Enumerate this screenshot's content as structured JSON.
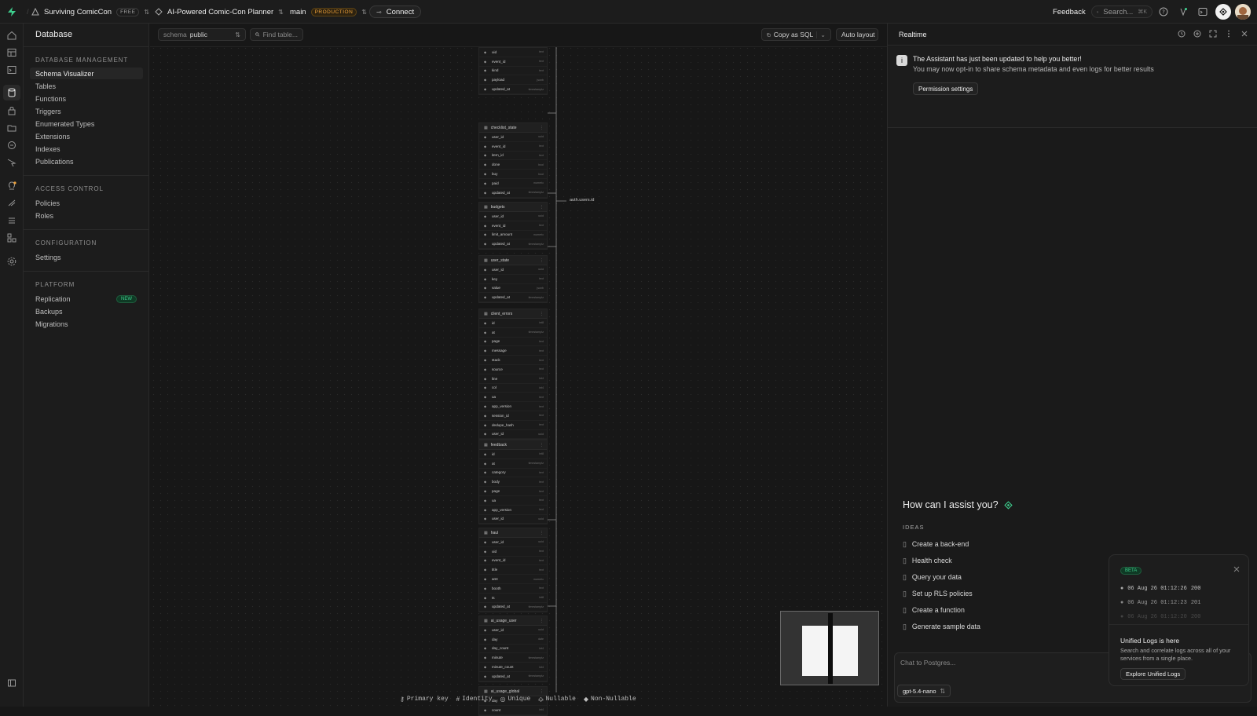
{
  "topbar": {
    "org_name": "Surviving ComicCon",
    "org_plan": "FREE",
    "project_name": "AI-Powered Comic-Con Planner",
    "branch_name": "main",
    "branch_env": "PRODUCTION",
    "connect_label": "Connect",
    "feedback_label": "Feedback",
    "search_placeholder": "Search...",
    "search_shortcut": "⌘K"
  },
  "sidebar": {
    "title": "Database",
    "groups": [
      {
        "heading": "DATABASE MANAGEMENT",
        "items": [
          "Schema Visualizer",
          "Tables",
          "Functions",
          "Triggers",
          "Enumerated Types",
          "Extensions",
          "Indexes",
          "Publications"
        ]
      },
      {
        "heading": "ACCESS CONTROL",
        "items": [
          "Policies",
          "Roles"
        ]
      },
      {
        "heading": "CONFIGURATION",
        "items": [
          "Settings"
        ]
      },
      {
        "heading": "PLATFORM",
        "items": [
          "Replication",
          "Backups",
          "Migrations"
        ]
      }
    ],
    "active_item": "Schema Visualizer",
    "new_badge": "NEW"
  },
  "toolbar": {
    "schema_label": "schema",
    "schema_value": "public",
    "find_placeholder": "Find table...",
    "copy_sql_label": "Copy as SQL",
    "auto_layout_label": "Auto layout"
  },
  "canvas": {
    "fk_label": "auth.users.id",
    "tables": [
      {
        "name": "",
        "columns": [
          [
            "uid",
            "text"
          ],
          [
            "event_id",
            "text"
          ],
          [
            "kind",
            "text"
          ],
          [
            "payload",
            "jsonb"
          ],
          [
            "updated_at",
            "timestamptz"
          ]
        ]
      },
      {
        "name": "checklist_state",
        "columns": [
          [
            "user_id",
            "uuid"
          ],
          [
            "event_id",
            "text"
          ],
          [
            "item_id",
            "text"
          ],
          [
            "done",
            "bool"
          ],
          [
            "buy",
            "bool"
          ],
          [
            "paid",
            "numeric"
          ],
          [
            "updated_at",
            "timestamptz"
          ]
        ]
      },
      {
        "name": "budgets",
        "columns": [
          [
            "user_id",
            "uuid"
          ],
          [
            "event_id",
            "text"
          ],
          [
            "limit_amount",
            "numeric"
          ],
          [
            "updated_at",
            "timestamptz"
          ]
        ]
      },
      {
        "name": "user_state",
        "columns": [
          [
            "user_id",
            "uuid"
          ],
          [
            "key",
            "text"
          ],
          [
            "value",
            "jsonb"
          ],
          [
            "updated_at",
            "timestamptz"
          ]
        ]
      },
      {
        "name": "client_errors",
        "columns": [
          [
            "id",
            "int8"
          ],
          [
            "at",
            "timestamptz"
          ],
          [
            "page",
            "text"
          ],
          [
            "message",
            "text"
          ],
          [
            "stack",
            "text"
          ],
          [
            "source",
            "text"
          ],
          [
            "line",
            "int4"
          ],
          [
            "col",
            "int4"
          ],
          [
            "ua",
            "text"
          ],
          [
            "app_version",
            "text"
          ],
          [
            "session_id",
            "text"
          ],
          [
            "dedupe_hash",
            "text"
          ],
          [
            "user_id",
            "uuid"
          ]
        ]
      },
      {
        "name": "feedback",
        "columns": [
          [
            "id",
            "int8"
          ],
          [
            "at",
            "timestamptz"
          ],
          [
            "category",
            "text"
          ],
          [
            "body",
            "text"
          ],
          [
            "page",
            "text"
          ],
          [
            "ua",
            "text"
          ],
          [
            "app_version",
            "text"
          ],
          [
            "user_id",
            "uuid"
          ]
        ]
      },
      {
        "name": "haul",
        "columns": [
          [
            "user_id",
            "uuid"
          ],
          [
            "uid",
            "text"
          ],
          [
            "event_id",
            "text"
          ],
          [
            "title",
            "text"
          ],
          [
            "amt",
            "numeric"
          ],
          [
            "booth",
            "text"
          ],
          [
            "ts",
            "int8"
          ],
          [
            "updated_at",
            "timestamptz"
          ]
        ]
      },
      {
        "name": "ai_usage_user",
        "columns": [
          [
            "user_id",
            "uuid"
          ],
          [
            "day",
            "date"
          ],
          [
            "day_count",
            "int4"
          ],
          [
            "minute",
            "timestamptz"
          ],
          [
            "minute_count",
            "int4"
          ],
          [
            "updated_at",
            "timestamptz"
          ]
        ]
      },
      {
        "name": "ai_usage_global",
        "columns": [
          [
            "day",
            "date"
          ],
          [
            "count",
            "int4"
          ]
        ]
      }
    ],
    "legend": [
      "Primary key",
      "Identity",
      "Unique",
      "Nullable",
      "Non-Nullable"
    ]
  },
  "panel": {
    "title": "Realtime",
    "notice_title": "The Assistant has just been updated to help you better!",
    "notice_body": "You may now opt-in to share schema metadata and even logs for better results",
    "permission_button": "Permission settings",
    "assist_heading": "How can I assist you?",
    "ideas_heading": "IDEAS",
    "ideas": [
      "Create a back-end",
      "Health check",
      "Query your data",
      "Set up RLS policies",
      "Create a function",
      "Generate sample data"
    ],
    "chat_placeholder": "Chat to Postgres...",
    "model": "gpt-5.4-nano"
  },
  "logs_popup": {
    "badge": "BETA",
    "entries": [
      {
        "time": "06 Aug 26 01:12:26",
        "status": "200"
      },
      {
        "time": "06 Aug 26 01:12:23",
        "status": "201"
      },
      {
        "time": "06 Aug 26 01:12:20",
        "status": "200"
      }
    ],
    "title": "Unified Logs is here",
    "body": "Search and correlate logs across all of your services from a single place.",
    "button": "Explore Unified Logs"
  },
  "colors": {
    "brand": "#3ecf8e",
    "warning": "#f0a33a",
    "background": "#171717"
  }
}
